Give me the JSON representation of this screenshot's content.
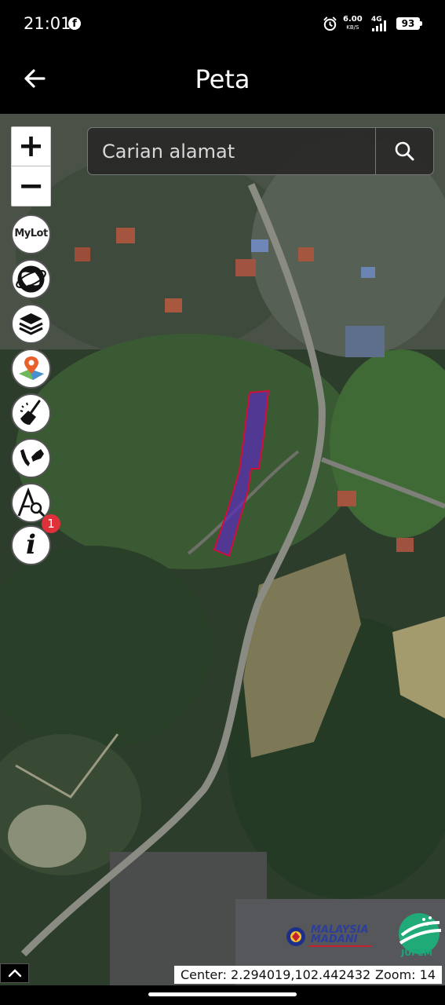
{
  "status_bar": {
    "time": "21:01",
    "net_speed": "6.00",
    "net_speed_unit": "KB/S",
    "network": "4G",
    "battery": "93"
  },
  "app_bar": {
    "title": "Peta"
  },
  "search": {
    "placeholder": "Carian alamat"
  },
  "zoom_controls": {
    "in_label": "+",
    "out_label": "−"
  },
  "tools": {
    "mylot_label": "MyLot",
    "info_label": "i",
    "info_badge": "1",
    "icons": [
      "mylot-icon",
      "globe-icon",
      "layers-icon",
      "map-pin-icon",
      "broom-icon",
      "malaysia-map-icon",
      "measure-search-icon",
      "info-icon"
    ]
  },
  "logos": {
    "madani": "MALAYSIA MADANI",
    "jupem": "JUPEM"
  },
  "readout": {
    "center": "Center: 2.294019,102.442432",
    "zoom": "Zoom: 14"
  },
  "colors": {
    "parcel_fill": "#5a2bb8",
    "parcel_stroke": "#d0103a",
    "badge": "#e0303a"
  }
}
